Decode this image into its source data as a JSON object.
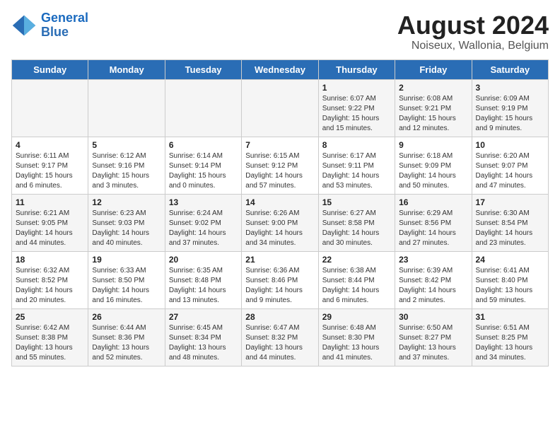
{
  "logo": {
    "text_general": "General",
    "text_blue": "Blue"
  },
  "title": "August 2024",
  "subtitle": "Noiseux, Wallonia, Belgium",
  "weekdays": [
    "Sunday",
    "Monday",
    "Tuesday",
    "Wednesday",
    "Thursday",
    "Friday",
    "Saturday"
  ],
  "weeks": [
    [
      {
        "day": "",
        "info": ""
      },
      {
        "day": "",
        "info": ""
      },
      {
        "day": "",
        "info": ""
      },
      {
        "day": "",
        "info": ""
      },
      {
        "day": "1",
        "info": "Sunrise: 6:07 AM\nSunset: 9:22 PM\nDaylight: 15 hours and 15 minutes."
      },
      {
        "day": "2",
        "info": "Sunrise: 6:08 AM\nSunset: 9:21 PM\nDaylight: 15 hours and 12 minutes."
      },
      {
        "day": "3",
        "info": "Sunrise: 6:09 AM\nSunset: 9:19 PM\nDaylight: 15 hours and 9 minutes."
      }
    ],
    [
      {
        "day": "4",
        "info": "Sunrise: 6:11 AM\nSunset: 9:17 PM\nDaylight: 15 hours and 6 minutes."
      },
      {
        "day": "5",
        "info": "Sunrise: 6:12 AM\nSunset: 9:16 PM\nDaylight: 15 hours and 3 minutes."
      },
      {
        "day": "6",
        "info": "Sunrise: 6:14 AM\nSunset: 9:14 PM\nDaylight: 15 hours and 0 minutes."
      },
      {
        "day": "7",
        "info": "Sunrise: 6:15 AM\nSunset: 9:12 PM\nDaylight: 14 hours and 57 minutes."
      },
      {
        "day": "8",
        "info": "Sunrise: 6:17 AM\nSunset: 9:11 PM\nDaylight: 14 hours and 53 minutes."
      },
      {
        "day": "9",
        "info": "Sunrise: 6:18 AM\nSunset: 9:09 PM\nDaylight: 14 hours and 50 minutes."
      },
      {
        "day": "10",
        "info": "Sunrise: 6:20 AM\nSunset: 9:07 PM\nDaylight: 14 hours and 47 minutes."
      }
    ],
    [
      {
        "day": "11",
        "info": "Sunrise: 6:21 AM\nSunset: 9:05 PM\nDaylight: 14 hours and 44 minutes."
      },
      {
        "day": "12",
        "info": "Sunrise: 6:23 AM\nSunset: 9:03 PM\nDaylight: 14 hours and 40 minutes."
      },
      {
        "day": "13",
        "info": "Sunrise: 6:24 AM\nSunset: 9:02 PM\nDaylight: 14 hours and 37 minutes."
      },
      {
        "day": "14",
        "info": "Sunrise: 6:26 AM\nSunset: 9:00 PM\nDaylight: 14 hours and 34 minutes."
      },
      {
        "day": "15",
        "info": "Sunrise: 6:27 AM\nSunset: 8:58 PM\nDaylight: 14 hours and 30 minutes."
      },
      {
        "day": "16",
        "info": "Sunrise: 6:29 AM\nSunset: 8:56 PM\nDaylight: 14 hours and 27 minutes."
      },
      {
        "day": "17",
        "info": "Sunrise: 6:30 AM\nSunset: 8:54 PM\nDaylight: 14 hours and 23 minutes."
      }
    ],
    [
      {
        "day": "18",
        "info": "Sunrise: 6:32 AM\nSunset: 8:52 PM\nDaylight: 14 hours and 20 minutes."
      },
      {
        "day": "19",
        "info": "Sunrise: 6:33 AM\nSunset: 8:50 PM\nDaylight: 14 hours and 16 minutes."
      },
      {
        "day": "20",
        "info": "Sunrise: 6:35 AM\nSunset: 8:48 PM\nDaylight: 14 hours and 13 minutes."
      },
      {
        "day": "21",
        "info": "Sunrise: 6:36 AM\nSunset: 8:46 PM\nDaylight: 14 hours and 9 minutes."
      },
      {
        "day": "22",
        "info": "Sunrise: 6:38 AM\nSunset: 8:44 PM\nDaylight: 14 hours and 6 minutes."
      },
      {
        "day": "23",
        "info": "Sunrise: 6:39 AM\nSunset: 8:42 PM\nDaylight: 14 hours and 2 minutes."
      },
      {
        "day": "24",
        "info": "Sunrise: 6:41 AM\nSunset: 8:40 PM\nDaylight: 13 hours and 59 minutes."
      }
    ],
    [
      {
        "day": "25",
        "info": "Sunrise: 6:42 AM\nSunset: 8:38 PM\nDaylight: 13 hours and 55 minutes."
      },
      {
        "day": "26",
        "info": "Sunrise: 6:44 AM\nSunset: 8:36 PM\nDaylight: 13 hours and 52 minutes."
      },
      {
        "day": "27",
        "info": "Sunrise: 6:45 AM\nSunset: 8:34 PM\nDaylight: 13 hours and 48 minutes."
      },
      {
        "day": "28",
        "info": "Sunrise: 6:47 AM\nSunset: 8:32 PM\nDaylight: 13 hours and 44 minutes."
      },
      {
        "day": "29",
        "info": "Sunrise: 6:48 AM\nSunset: 8:30 PM\nDaylight: 13 hours and 41 minutes."
      },
      {
        "day": "30",
        "info": "Sunrise: 6:50 AM\nSunset: 8:27 PM\nDaylight: 13 hours and 37 minutes."
      },
      {
        "day": "31",
        "info": "Sunrise: 6:51 AM\nSunset: 8:25 PM\nDaylight: 13 hours and 34 minutes."
      }
    ]
  ]
}
